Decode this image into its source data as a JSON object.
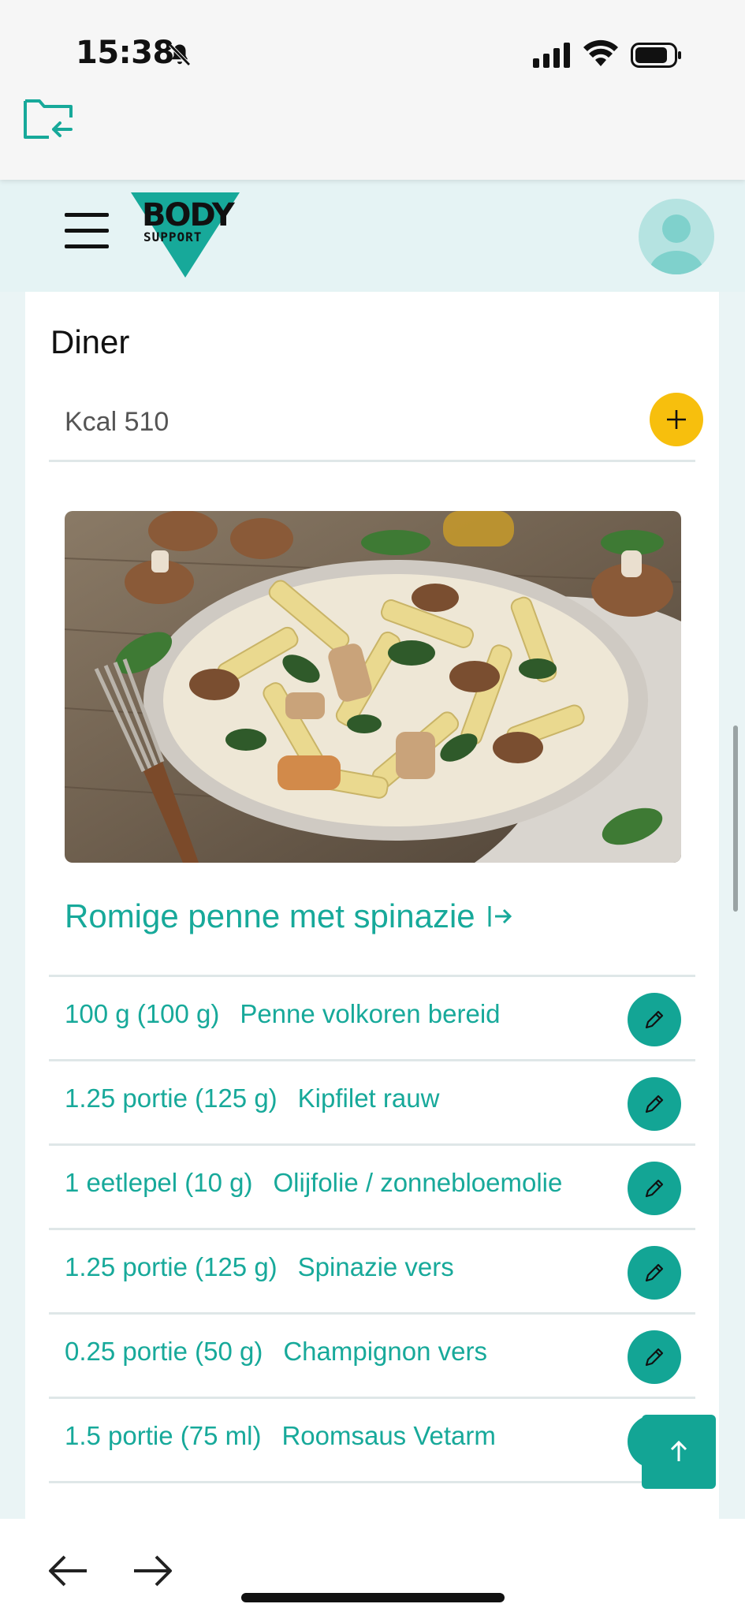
{
  "status_bar": {
    "time": "15:38",
    "icons": [
      "bell-off-icon",
      "signal-icon",
      "wifi-icon",
      "battery-icon"
    ]
  },
  "browser": {
    "top_icon": "folder-return-icon",
    "bottom_icons": [
      "back-arrow-icon",
      "forward-arrow-icon"
    ]
  },
  "header": {
    "logo_text_top": "BODY",
    "logo_text_bottom": "SUPPORT",
    "icons": [
      "hamburger-menu-icon",
      "user-avatar-icon"
    ],
    "accent_color": "#17a99a"
  },
  "meal": {
    "title": "Diner",
    "kcal": "Kcal 510",
    "add_icon": "plus-icon",
    "add_button_color": "#f7bf0d",
    "photo": "creamy-penne-dish-photo",
    "recipe_title": "Romige penne met spinazie",
    "recipe_link_icon": "open-link-arrow-icon",
    "ingredients": [
      {
        "qty": "100 g (100 g)",
        "name": "Penne volkoren bereid"
      },
      {
        "qty": "1.25 portie (125 g)",
        "name": "Kipfilet rauw"
      },
      {
        "qty": "1 eetlepel (10 g)",
        "name": "Olijfolie / zonnebloemolie"
      },
      {
        "qty": "1.25 portie (125 g)",
        "name": "Spinazie vers"
      },
      {
        "qty": "0.25 portie (50 g)",
        "name": "Champignon vers"
      },
      {
        "qty": "1.5 portie (75 ml)",
        "name": "Roomsaus Vetarm"
      }
    ],
    "edit_icon": "pencil-icon"
  },
  "scroll_top_icon": "arrow-up-icon"
}
